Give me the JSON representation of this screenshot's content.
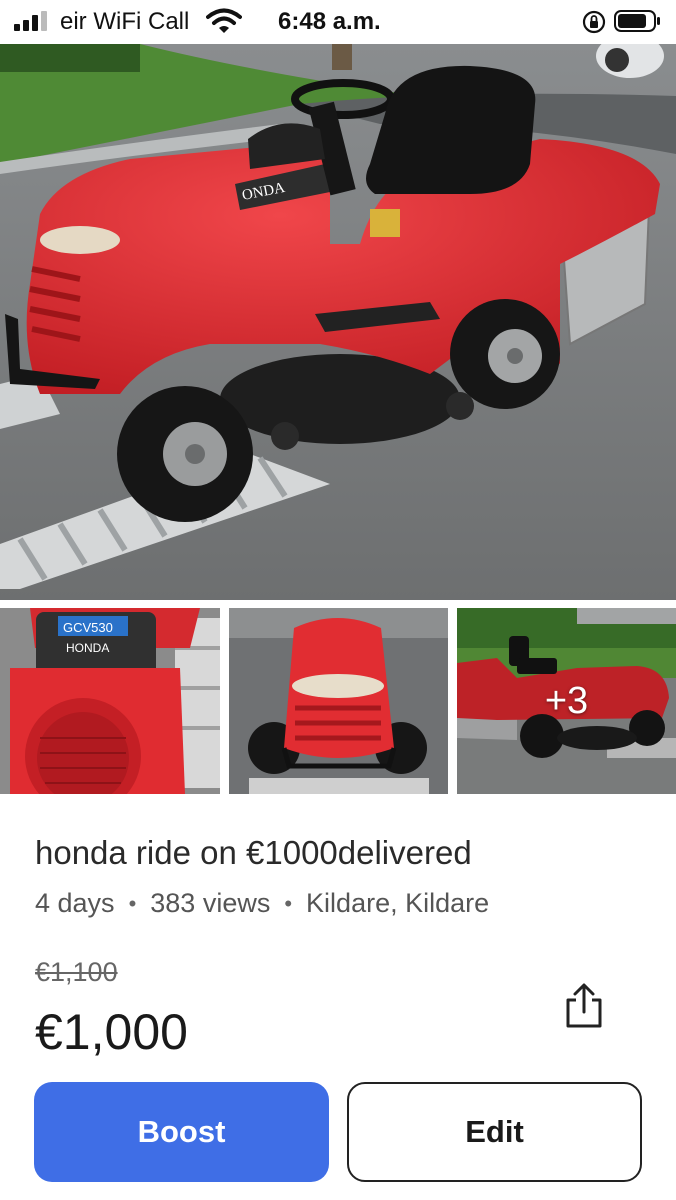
{
  "status_bar": {
    "carrier": "eir WiFi Call",
    "time": "6:48 a.m."
  },
  "gallery": {
    "hero_alt": "Red Honda ride-on lawn mower on ramps",
    "thumbnails": [
      {
        "alt": "Honda GCV530 engine close-up"
      },
      {
        "alt": "Front view of red mower"
      },
      {
        "alt": "Side view of red mower on lawn"
      }
    ],
    "more_count": "+3"
  },
  "listing": {
    "title": "honda ride on €1000delivered",
    "age": "4 days",
    "views": "383 views",
    "location": "Kildare, Kildare",
    "old_price": "€1,100",
    "price": "€1,000"
  },
  "actions": {
    "boost_label": "Boost",
    "edit_label": "Edit"
  },
  "colors": {
    "accent": "#3f6ee6",
    "mower_red": "#d9262c"
  }
}
